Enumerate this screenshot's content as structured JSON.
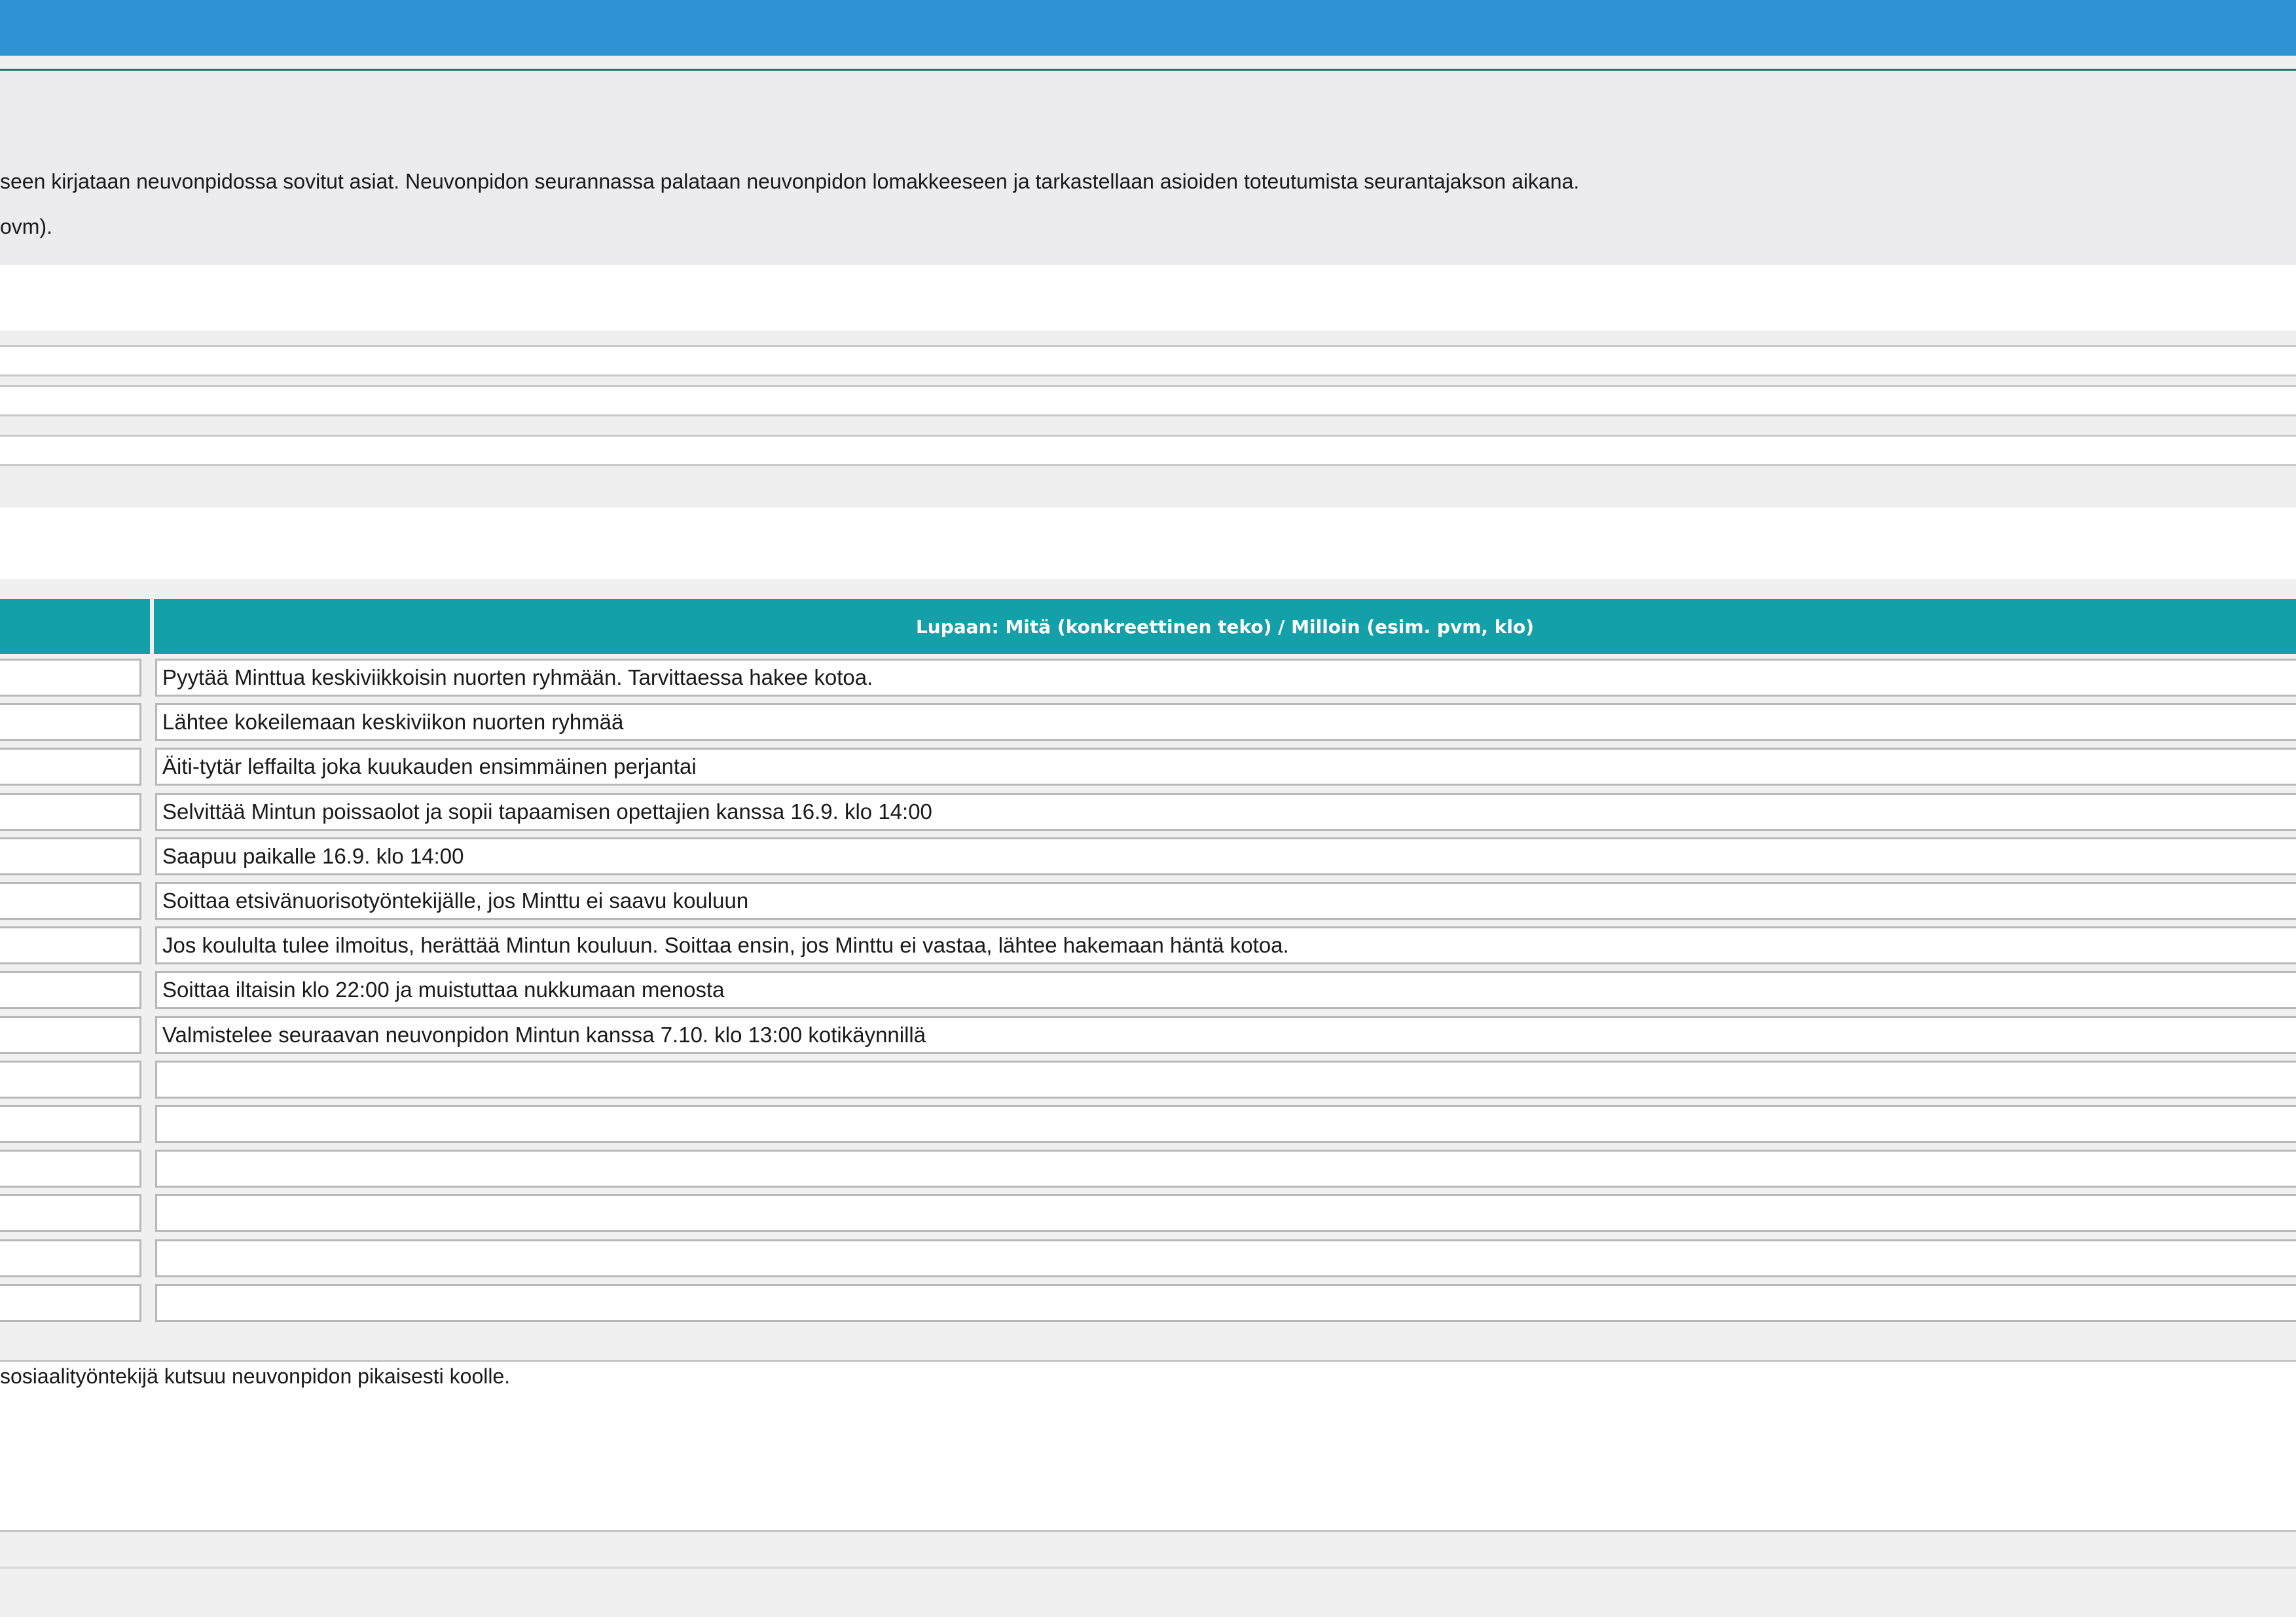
{
  "intro": {
    "line1": "seen kirjataan neuvonpidossa sovitut asiat. Neuvonpidon seurannassa palataan neuvonpidon lomakkeeseen ja tarkastellaan asioiden toteutumista seurantajakson aikana.",
    "line2": "ovm)."
  },
  "table": {
    "header_right": "Lupaan: Mitä (konkreettinen teko) / Milloin (esim. pvm, klo)",
    "rows": [
      {
        "promise": "Pyytää Minttua keskiviikkoisin nuorten ryhmään. Tarvittaessa hakee kotoa."
      },
      {
        "promise": "Lähtee kokeilemaan keskiviikon nuorten ryhmää"
      },
      {
        "promise": "Äiti-tytär leffailta joka kuukauden ensimmäinen perjantai"
      },
      {
        "promise": "Selvittää Mintun poissaolot ja sopii tapaamisen opettajien kanssa 16.9. klo 14:00"
      },
      {
        "promise": "Saapuu paikalle 16.9. klo 14:00"
      },
      {
        "promise": "Soittaa etsivänuorisotyöntekijälle, jos Minttu ei saavu kouluun"
      },
      {
        "promise": "Jos koululta tulee ilmoitus, herättää Mintun kouluun. Soittaa ensin, jos Minttu ei vastaa, lähtee hakemaan häntä kotoa."
      },
      {
        "promise": "Soittaa iltaisin klo 22:00 ja muistuttaa nukkumaan menosta"
      },
      {
        "promise": "Valmistelee seuraavan neuvonpidon Mintun kanssa 7.10. klo 13:00 kotikäynnillä"
      },
      {
        "promise": ""
      },
      {
        "promise": ""
      },
      {
        "promise": ""
      },
      {
        "promise": ""
      },
      {
        "promise": ""
      },
      {
        "promise": ""
      }
    ]
  },
  "footer": {
    "text": " sosiaalityöntekijä kutsuu neuvonpidon pikaisesti koolle."
  }
}
